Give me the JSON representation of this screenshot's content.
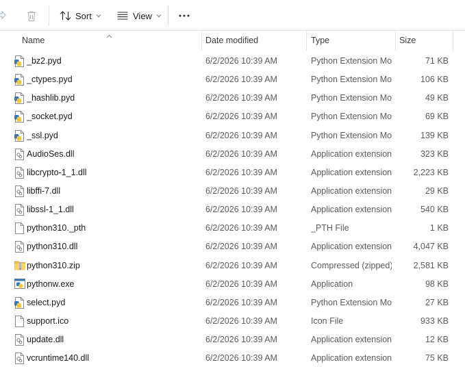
{
  "toolbar": {
    "share_icon": "share-icon",
    "delete_icon": "trash-icon",
    "sort_label": "Sort",
    "view_label": "View",
    "more_icon": "more-options-icon"
  },
  "columns": {
    "name": "Name",
    "date_modified": "Date modified",
    "type": "Type",
    "size": "Size"
  },
  "files": [
    {
      "name": "_bz2.pyd",
      "date": "6/2/2026 10:39 AM",
      "type": "Python Extension Mo...",
      "size": "71 KB",
      "icon": "python-file-icon"
    },
    {
      "name": "_ctypes.pyd",
      "date": "6/2/2026 10:39 AM",
      "type": "Python Extension Mo...",
      "size": "106 KB",
      "icon": "python-file-icon"
    },
    {
      "name": "_hashlib.pyd",
      "date": "6/2/2026 10:39 AM",
      "type": "Python Extension Mo...",
      "size": "49 KB",
      "icon": "python-file-icon"
    },
    {
      "name": "_socket.pyd",
      "date": "6/2/2026 10:39 AM",
      "type": "Python Extension Mo...",
      "size": "69 KB",
      "icon": "python-file-icon"
    },
    {
      "name": "_ssl.pyd",
      "date": "6/2/2026 10:39 AM",
      "type": "Python Extension Mo...",
      "size": "139 KB",
      "icon": "python-file-icon"
    },
    {
      "name": "AudioSes.dll",
      "date": "6/2/2026 10:39 AM",
      "type": "Application extension",
      "size": "323 KB",
      "icon": "dll-file-icon"
    },
    {
      "name": "libcrypto-1_1.dll",
      "date": "6/2/2026 10:39 AM",
      "type": "Application extension",
      "size": "2,223 KB",
      "icon": "dll-file-icon"
    },
    {
      "name": "libffi-7.dll",
      "date": "6/2/2026 10:39 AM",
      "type": "Application extension",
      "size": "29 KB",
      "icon": "dll-file-icon"
    },
    {
      "name": "libssl-1_1.dll",
      "date": "6/2/2026 10:39 AM",
      "type": "Application extension",
      "size": "540 KB",
      "icon": "dll-file-icon"
    },
    {
      "name": "python310._pth",
      "date": "6/2/2026 10:39 AM",
      "type": "_PTH File",
      "size": "1 KB",
      "icon": "blank-file-icon"
    },
    {
      "name": "python310.dll",
      "date": "6/2/2026 10:39 AM",
      "type": "Application extension",
      "size": "4,047 KB",
      "icon": "dll-file-icon"
    },
    {
      "name": "python310.zip",
      "date": "6/2/2026 10:39 AM",
      "type": "Compressed (zipped)...",
      "size": "2,581 KB",
      "icon": "zip-folder-icon"
    },
    {
      "name": "pythonw.exe",
      "date": "6/2/2026 10:39 AM",
      "type": "Application",
      "size": "98 KB",
      "icon": "python-exe-icon"
    },
    {
      "name": "select.pyd",
      "date": "6/2/2026 10:39 AM",
      "type": "Python Extension Mo...",
      "size": "27 KB",
      "icon": "python-file-icon"
    },
    {
      "name": "support.ico",
      "date": "6/2/2026 10:39 AM",
      "type": "Icon File",
      "size": "933 KB",
      "icon": "blank-file-icon"
    },
    {
      "name": "update.dll",
      "date": "6/2/2026 10:39 AM",
      "type": "Application extension",
      "size": "12 KB",
      "icon": "dll-file-icon"
    },
    {
      "name": "vcruntime140.dll",
      "date": "6/2/2026 10:39 AM",
      "type": "Application extension",
      "size": "75 KB",
      "icon": "dll-file-icon"
    }
  ]
}
